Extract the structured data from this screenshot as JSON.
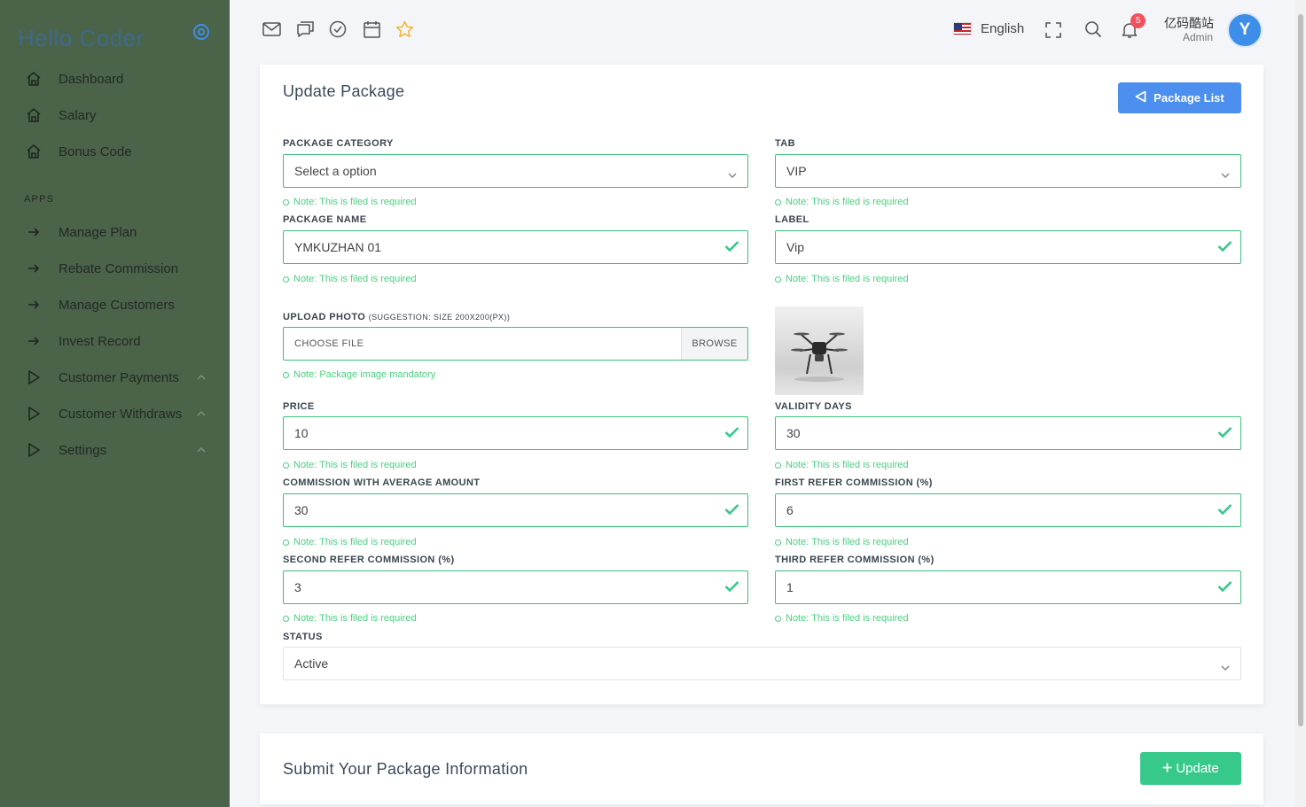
{
  "sidebar": {
    "brand": "Hello Coder",
    "items": [
      {
        "label": "Dashboard",
        "icon": "home-icon"
      },
      {
        "label": "Salary",
        "icon": "home-icon"
      },
      {
        "label": "Bonus Code",
        "icon": "home-icon"
      }
    ],
    "apps_heading": "APPS",
    "apps": [
      {
        "label": "Manage Plan",
        "icon": "arrow-right-icon"
      },
      {
        "label": "Rebate Commission",
        "icon": "arrow-right-icon"
      },
      {
        "label": "Manage Customers",
        "icon": "arrow-right-icon"
      },
      {
        "label": "Invest Record",
        "icon": "arrow-right-icon"
      },
      {
        "label": "Customer Payments",
        "icon": "play-icon"
      },
      {
        "label": "Customer Withdraws",
        "icon": "play-icon"
      },
      {
        "label": "Settings",
        "icon": "play-icon"
      }
    ]
  },
  "topbar": {
    "language": "English",
    "notification_count": "5",
    "user_name": "亿码酷站",
    "user_role": "Admin",
    "avatar_text": "Y"
  },
  "form": {
    "title": "Update Package",
    "package_list_button": "Package List",
    "package_category_label": "PACKAGE CATEGORY",
    "package_category_value": "Select a option",
    "tab_label": "TAB",
    "tab_value": "VIP",
    "required_note": "Note: This is filed is required",
    "package_name_label": "PACKAGE NAME",
    "package_name_value": "YMKUZHAN 01",
    "label_label": "LABEL",
    "label_value": "Vip",
    "upload_photo_label": "UPLOAD PHOTO",
    "upload_photo_hint": "(SUGGESTION: SIZE 200X200(PX))",
    "choose_file": "CHOOSE FILE",
    "browse": "BROWSE",
    "image_note": "Note: Package image mandatory",
    "price_label": "PRICE",
    "price_value": "10",
    "validity_label": "VALIDITY DAYS",
    "validity_value": "30",
    "commission_avg_label": "COMMISSION WITH AVERAGE AMOUNT",
    "commission_avg_value": "30",
    "first_refer_label": "FIRST REFER COMMISSION (%)",
    "first_refer_value": "6",
    "second_refer_label": "SECOND REFER COMMISSION (%)",
    "second_refer_value": "3",
    "third_refer_label": "THIRD REFER COMMISSION (%)",
    "third_refer_value": "1",
    "status_label": "STATUS",
    "status_value": "Active"
  },
  "submit": {
    "title": "Submit Your Package Information",
    "update_button": "Update"
  }
}
